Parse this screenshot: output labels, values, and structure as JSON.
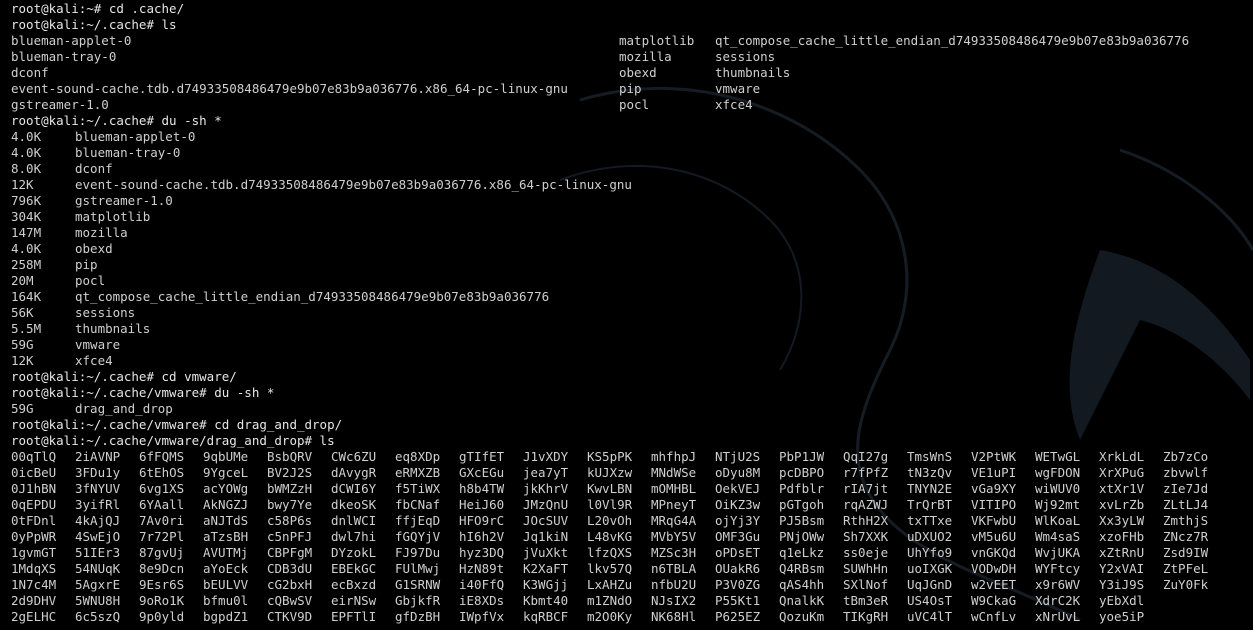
{
  "colors": {
    "background": "#000000",
    "text": "#cfcfcf",
    "watermark": "#1b2430"
  },
  "prompts": {
    "p1": "root@kali:~# cd .cache/",
    "p2": "root@kali:~/.cache# ls",
    "p3": "root@kali:~/.cache# du -sh *",
    "p4": "root@kali:~/.cache# cd vmware/",
    "p5": "root@kali:~/.cache/vmware# du -sh *",
    "p6": "root@kali:~/.cache/vmware# cd drag_and_drop/",
    "p7": "root@kali:~/.cache/vmware/drag_and_drop# ls"
  },
  "ls_cache": {
    "col1": [
      "blueman-applet-0",
      "blueman-tray-0",
      "dconf",
      "event-sound-cache.tdb.d74933508486479e9b07e83b9a036776.x86_64-pc-linux-gnu",
      "gstreamer-1.0"
    ],
    "col2": [
      "matplotlib",
      "mozilla",
      "obexd",
      "pip",
      "pocl"
    ],
    "col3": [
      "qt_compose_cache_little_endian_d74933508486479e9b07e83b9a036776",
      "sessions",
      "thumbnails",
      "vmware",
      "xfce4"
    ]
  },
  "du_cache": [
    {
      "size": "4.0K",
      "name": "blueman-applet-0"
    },
    {
      "size": "4.0K",
      "name": "blueman-tray-0"
    },
    {
      "size": "8.0K",
      "name": "dconf"
    },
    {
      "size": "12K",
      "name": "event-sound-cache.tdb.d74933508486479e9b07e83b9a036776.x86_64-pc-linux-gnu"
    },
    {
      "size": "796K",
      "name": "gstreamer-1.0"
    },
    {
      "size": "304K",
      "name": "matplotlib"
    },
    {
      "size": "147M",
      "name": "mozilla"
    },
    {
      "size": "4.0K",
      "name": "obexd"
    },
    {
      "size": "258M",
      "name": "pip"
    },
    {
      "size": "20M",
      "name": "pocl"
    },
    {
      "size": "164K",
      "name": "qt_compose_cache_little_endian_d74933508486479e9b07e83b9a036776"
    },
    {
      "size": "56K",
      "name": "sessions"
    },
    {
      "size": "5.5M",
      "name": "thumbnails"
    },
    {
      "size": "59G",
      "name": "vmware"
    },
    {
      "size": "12K",
      "name": "xfce4"
    }
  ],
  "du_vmware": [
    {
      "size": "59G",
      "name": "drag_and_drop"
    }
  ],
  "ls_dnd": [
    [
      "00qTlQ",
      "2iAVNP",
      "6fFQMS",
      "9qbUMe",
      "BsbQRV",
      "CWc6ZU",
      "eq8XDp",
      "gTIfET",
      "J1vXDY",
      "KS5pPK",
      "mhfhpJ",
      "NTjU2S",
      "PbP1JW",
      "QqI27g",
      "TmsWnS",
      "V2PtWK",
      "WETwGL",
      "XrkLdL",
      "Zb7zCo"
    ],
    [
      "0icBeU",
      "3FDu1y",
      "6tEhOS",
      "9YgceL",
      "BV2J2S",
      "dAvygR",
      "eRMXZB",
      "GXcEGu",
      "jea7yT",
      "kUJXzw",
      "MNdWSe",
      "oDyu8M",
      "pcDBPO",
      "r7fPfZ",
      "tN3zQv",
      "VE1uPI",
      "wgFDON",
      "XrXPuG",
      "zbvwlf"
    ],
    [
      "0J1hBN",
      "3fNYUV",
      "6vg1XS",
      "acYOWg",
      "bWMZzH",
      "dCWI6Y",
      "f5TiWX",
      "h8b4TW",
      "jkKhrV",
      "KwvLBN",
      "mOMHBL",
      "OekVEJ",
      "Pdfblr",
      "rIA7jt",
      "TNYN2E",
      "vGa9XY",
      "wiWUV0",
      "xtXr1V",
      "zIe7Jd"
    ],
    [
      "0qEPDU",
      "3yifRl",
      "6YAall",
      "AkNGZJ",
      "bwy7Ye",
      "dkeoSK",
      "fbCNaf",
      "HeiJ60",
      "JMzQnU",
      "l0Vl9R",
      "MPneyT",
      "OiKZ3w",
      "pGTgoh",
      "rqAZWJ",
      "TrQrBT",
      "VITIPO",
      "Wj92mt",
      "xvLrZb",
      "ZLtLJ4"
    ],
    [
      "0tFDnl",
      "4kAjQJ",
      "7Av0ri",
      "aNJTdS",
      "c58P6s",
      "dnlWCI",
      "ffjEqD",
      "HFO9rC",
      "JOcSUV",
      "L20vOh",
      "MRqG4A",
      "ojYj3Y",
      "PJ5Bsm",
      "RthH2X",
      "txTTxe",
      "VKFwbU",
      "WlKoaL",
      "Xx3yLW",
      "ZmthjS"
    ],
    [
      "0yPpWR",
      "4SwEjO",
      "7r72Pl",
      "aTzsBH",
      "c5nPFJ",
      "dwl7hi",
      "fGQYjV",
      "hI6h2V",
      "Jq1kiN",
      "L48vKG",
      "MVbY5V",
      "OMF3Gu",
      "PNjOWw",
      "Sh7XXK",
      "uDXUO2",
      "vM5u6U",
      "Wm4saS",
      "xzoFHb",
      "ZNcz7R"
    ],
    [
      "1gvmGT",
      "51IEr3",
      "87gvUj",
      "AVUTMj",
      "CBPFgM",
      "DYzokL",
      "FJ97Du",
      "hyz3DQ",
      "jVuXkt",
      "lfzQXS",
      "MZSc3H",
      "oPDsET",
      "q1eLkz",
      "ss0eje",
      "UhYfo9",
      "vnGKQd",
      "WvjUKA",
      "xZtRnU",
      "Zsd9IW"
    ],
    [
      "1MdqXS",
      "54NUqK",
      "8e9Dcn",
      "aYoEck",
      "CDB3dU",
      "EBEkGC",
      "FUlMwj",
      "HzN89t",
      "K2XaFT",
      "lkv57Q",
      "n6TBLA",
      "OUakR6",
      "Q4RBsm",
      "SUWhHn",
      "uoIXGK",
      "VODwDH",
      "WYFtcy",
      "Y2xVAI",
      "ZtPFeL"
    ],
    [
      "1N7c4M",
      "5AgxrE",
      "9Esr6S",
      "bEULVV",
      "cG2bxH",
      "ecBxzd",
      "G1SRNW",
      "i40FfQ",
      "K3WGjj",
      "LxAHZu",
      "nfbU2U",
      "P3V0ZG",
      "qAS4hh",
      "SXlNof",
      "UqJGnD",
      "w2vEET",
      "x9r6WV",
      "Y3iJ9S",
      "ZuY0Fk"
    ],
    [
      "2d9DHV",
      "5WNU8H",
      "9oRo1K",
      "bfmu0l",
      "cQBwSV",
      "eirNSw",
      "GbjkfR",
      "iE8XDs",
      "Kbmt40",
      "m1ZNdO",
      "NJsIX2",
      "P55Kt1",
      "QnalkK",
      "tBm3eR",
      "US4OsT",
      "W9CkaG",
      "XdrC2K",
      "yEbXdl",
      ""
    ],
    [
      "2gELHC",
      "6c5szQ",
      "9p0yld",
      "bgpdZ1",
      "CTKV9D",
      "EPFTlI",
      "gfDzBH",
      "IWpfVx",
      "kqRBCF",
      "m2O0Ky",
      "NK68Hl",
      "P625EZ",
      "QozuKm",
      "TIKgRH",
      "uVC4lT",
      "wCnfLv",
      "xNrUvL",
      "yoe5iP",
      ""
    ]
  ]
}
